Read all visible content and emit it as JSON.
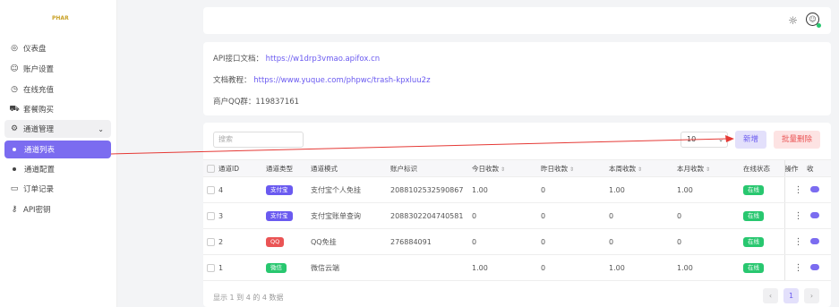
{
  "brand": {
    "logo_text": "PHAR"
  },
  "sidebar": {
    "items": [
      {
        "label": "仪表盘",
        "icon": "dashboard-icon",
        "glyph": "◎"
      },
      {
        "label": "账户设置",
        "icon": "user-settings-icon",
        "glyph": "☺"
      },
      {
        "label": "在线充值",
        "icon": "recharge-icon",
        "glyph": "◷"
      },
      {
        "label": "套餐购买",
        "icon": "cart-icon",
        "glyph": "⛟"
      },
      {
        "label": "通道管理",
        "icon": "channel-icon",
        "glyph": "⚙"
      },
      {
        "label": "通道列表"
      },
      {
        "label": "通道配置"
      },
      {
        "label": "订单记录",
        "icon": "order-icon",
        "glyph": "▭"
      },
      {
        "label": "API密钥",
        "icon": "key-icon",
        "glyph": "⚷"
      }
    ]
  },
  "info": {
    "doc_label": "API接口文档：",
    "doc_link": "https://w1drp3vmao.apifox.cn",
    "tutorial_label": "文档教程：",
    "tutorial_link": "https://www.yuque.com/phpwc/trash-kpxluu2z",
    "qq_text": "商户QQ群：119837161"
  },
  "toolbar": {
    "search_placeholder": "搜索",
    "page_size": "10",
    "add_label": "新增",
    "bulk_delete_label": "批量删除"
  },
  "table": {
    "headers": [
      "通道ID",
      "通道类型",
      "通道模式",
      "账户标识",
      "今日收款",
      "昨日收款",
      "本周收款",
      "本月收款",
      "在线状态",
      "操作",
      "收"
    ],
    "rows": [
      {
        "id": "4",
        "type": "支付宝",
        "type_color": "#6a5af0",
        "mode": "支付宝个人免挂",
        "account": "2088102532590867",
        "today": "1.00",
        "yesterday": "0",
        "week": "1.00",
        "month": "1.00",
        "status": "在线"
      },
      {
        "id": "3",
        "type": "支付宝",
        "type_color": "#6a5af0",
        "mode": "支付宝账单查询",
        "account": "2088302204740581",
        "today": "0",
        "yesterday": "0",
        "week": "0",
        "month": "0",
        "status": "在线"
      },
      {
        "id": "2",
        "type": "QQ",
        "type_color": "#ea5455",
        "mode": "QQ免挂",
        "account": "276884091",
        "today": "0",
        "yesterday": "0",
        "week": "0",
        "month": "0",
        "status": "在线"
      },
      {
        "id": "1",
        "type": "微信",
        "type_color": "#28c76f",
        "mode": "微信云端",
        "account": "",
        "today": "1.00",
        "yesterday": "0",
        "week": "1.00",
        "month": "1.00",
        "status": "在线"
      }
    ],
    "status_color": "#28c76f"
  },
  "footer": {
    "summary": "显示 1 到 4 的 4 数据",
    "prev": "‹",
    "current_page": "1",
    "next": "›"
  }
}
